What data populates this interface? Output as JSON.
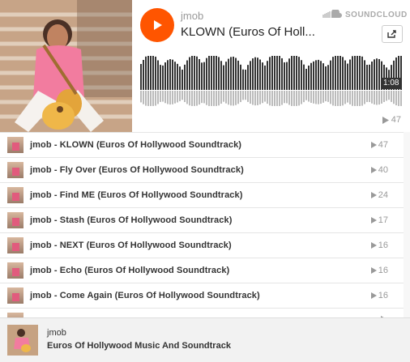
{
  "player": {
    "artist": "jmob",
    "title": "KLOWN (Euros Of Holl...",
    "brand": "SOUNDCLOUD",
    "duration": "1:08",
    "play_count": "47",
    "accent_color": "#ff5500",
    "icons": {
      "play": "play-icon",
      "cloud": "soundcloud-cloud-icon",
      "share": "share-icon",
      "count": "play-count-icon"
    }
  },
  "tracks": [
    {
      "label": "jmob - KLOWN (Euros Of Hollywood Soundtrack)",
      "count": "47"
    },
    {
      "label": "jmob - Fly Over (Euros Of Hollywood Soundtrack)",
      "count": "40"
    },
    {
      "label": "jmob - Find ME (Euros Of Hollywood Soundtrack)",
      "count": "24"
    },
    {
      "label": "jmob - Stash (Euros Of Hollywood Soundtrack)",
      "count": "17"
    },
    {
      "label": "jmob - NEXT (Euros Of Hollywood Soundtrack)",
      "count": "16"
    },
    {
      "label": "jmob - Echo (Euros Of Hollywood Soundtrack)",
      "count": "16"
    },
    {
      "label": "jmob - Come Again (Euros Of Hollywood Soundtrack)",
      "count": "16"
    },
    {
      "label": "",
      "count": ""
    }
  ],
  "footer": {
    "artist": "jmob",
    "playlist": "Euros Of Hollywood Music And Soundtrack"
  }
}
